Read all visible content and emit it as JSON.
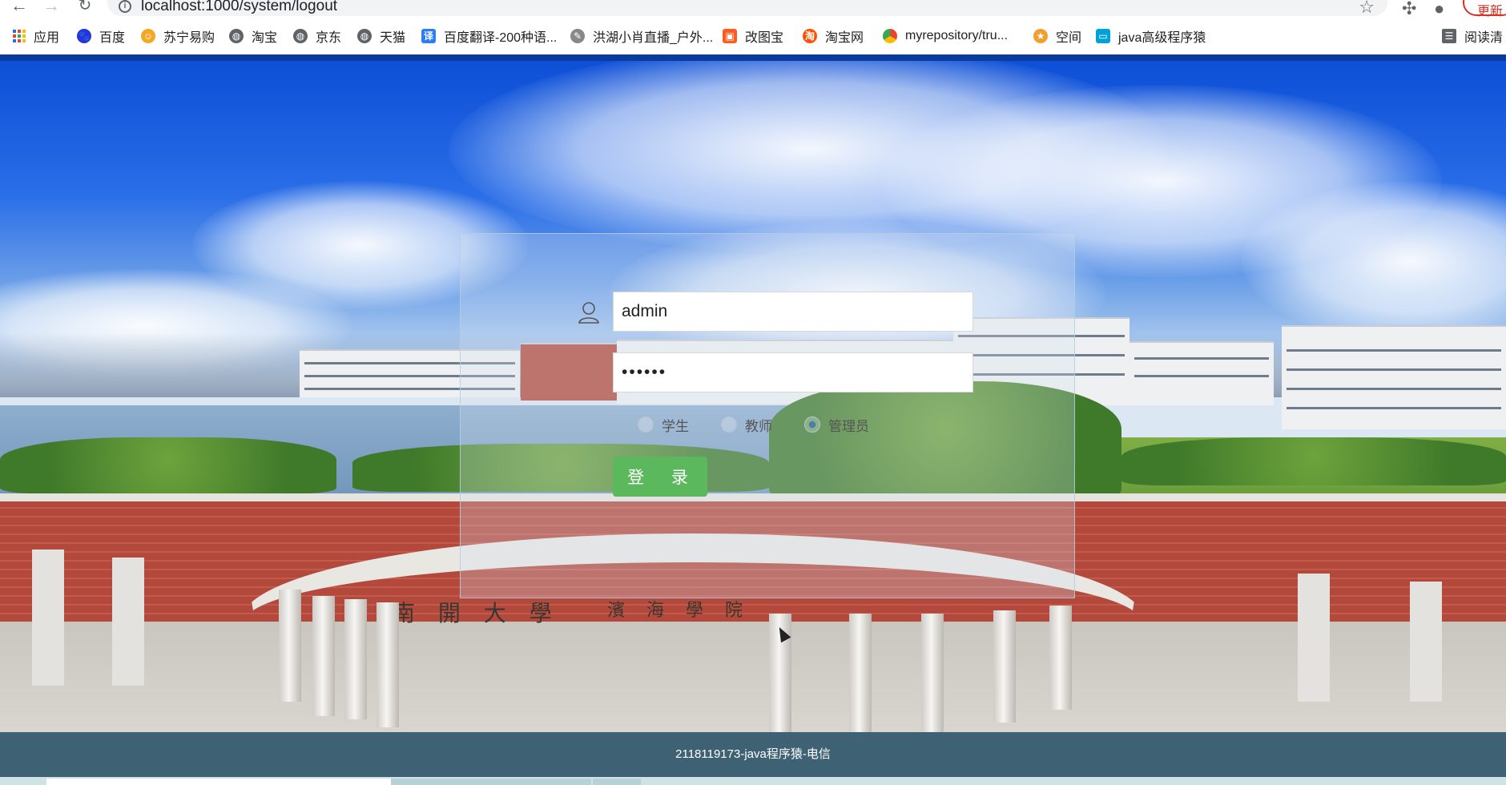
{
  "browser": {
    "url": "localhost:1000/system/logout",
    "update_label": "更新",
    "bookmarks": [
      {
        "label": "应用",
        "icon": "apps-grid-icon"
      },
      {
        "label": "百度",
        "icon": "baidu-paw-icon",
        "color": "#2932e1"
      },
      {
        "label": "苏宁易购",
        "icon": "suning-icon",
        "color": "#f5a623"
      },
      {
        "label": "淘宝",
        "icon": "globe-icon",
        "color": "#5f6368"
      },
      {
        "label": "京东",
        "icon": "globe-icon",
        "color": "#5f6368"
      },
      {
        "label": "天猫",
        "icon": "globe-icon",
        "color": "#5f6368"
      },
      {
        "label": "百度翻译-200种语...",
        "icon": "translate-icon",
        "color": "#2b7cf6"
      },
      {
        "label": "洪湖小肖直播_户外...",
        "icon": "feather-icon",
        "color": "#888888"
      },
      {
        "label": "改图宝",
        "icon": "image-tool-icon",
        "color": "#ff5a1f"
      },
      {
        "label": "淘宝网",
        "icon": "taobao-icon",
        "color": "#ff5000"
      },
      {
        "label": "myrepository/tru...",
        "icon": "chrome-icon",
        "color": "#34a853"
      },
      {
        "label": "空间",
        "icon": "qzone-icon",
        "color": "#f0a030"
      },
      {
        "label": "java高级程序猿",
        "icon": "bilibili-icon",
        "color": "#00a1d6"
      },
      {
        "label": "阅读清",
        "icon": "reading-list-icon",
        "color": "#5f6368"
      }
    ]
  },
  "login": {
    "username": "admin",
    "password": "••••••",
    "roles": [
      {
        "label": "学生",
        "checked": false
      },
      {
        "label": "教师",
        "checked": false
      },
      {
        "label": "管理员",
        "checked": true
      }
    ],
    "submit_label": "登 录"
  },
  "banner": {
    "arch_left": "南 開 大 學",
    "arch_right": "濱 海 學 院"
  },
  "footer": {
    "text": "2118119173-java程序猿-电信"
  },
  "colors": {
    "stripe": "#0a3b9c",
    "login_button": "#5cb85c",
    "footer": "#3e6273"
  }
}
